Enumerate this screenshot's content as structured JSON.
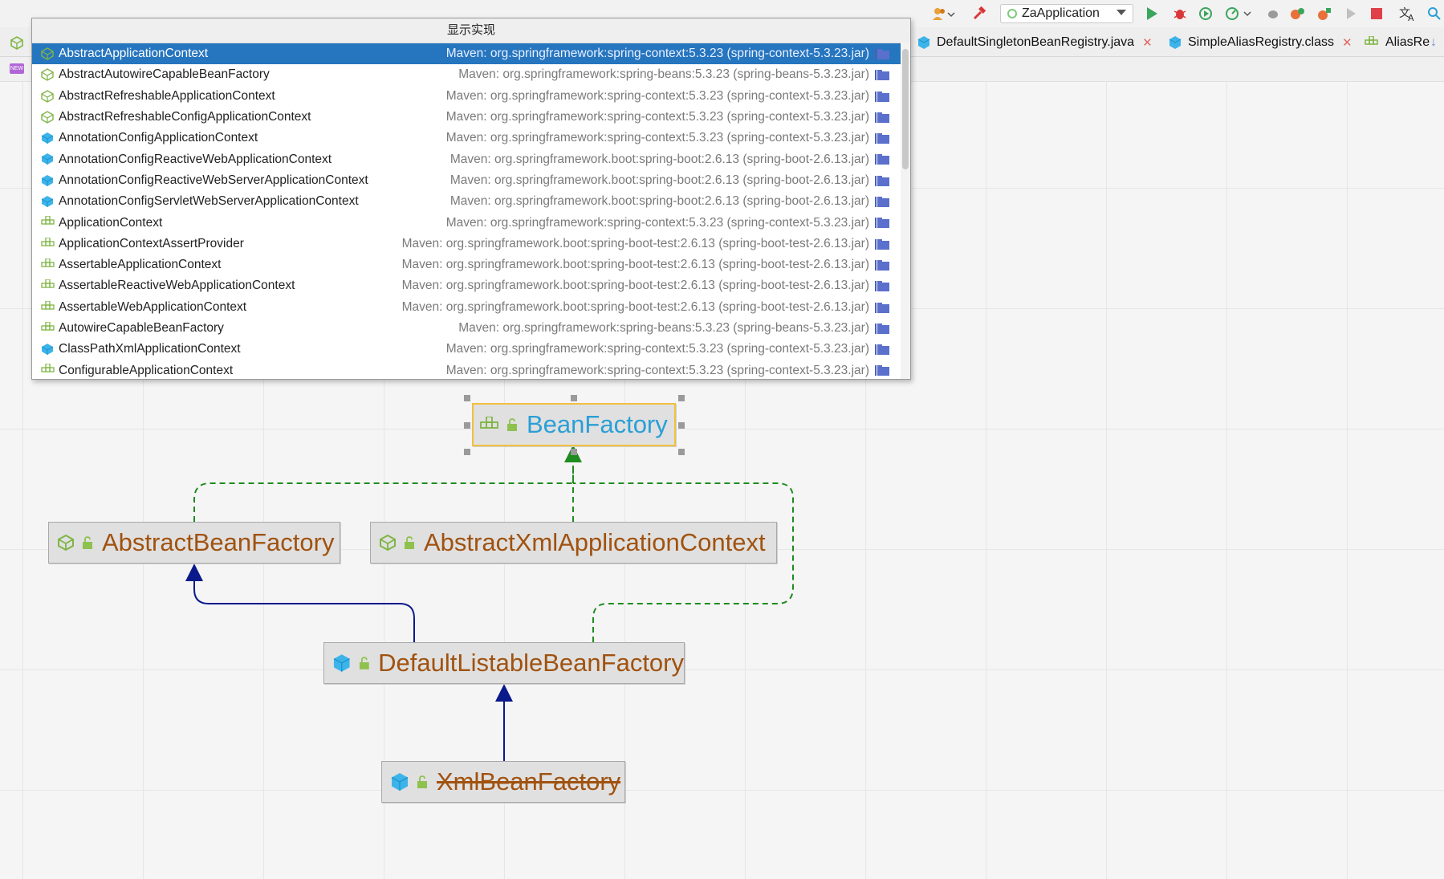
{
  "toolbar": {
    "run_config": "ZaApplication"
  },
  "tabs": [
    {
      "label": "DefaultSingletonBeanRegistry.java",
      "icon": "class-icon"
    },
    {
      "label": "SimpleAliasRegistry.class",
      "icon": "class-icon"
    },
    {
      "label": "AliasRe",
      "icon": "interface-icon"
    }
  ],
  "subbar": {
    "badge": "NEW"
  },
  "popup": {
    "title": "显示实现",
    "items": [
      {
        "name": "AbstractApplicationContext",
        "location": "Maven: org.springframework:spring-context:5.3.23 (spring-context-5.3.23.jar)",
        "kind": "abstract-class",
        "selected": true
      },
      {
        "name": "AbstractAutowireCapableBeanFactory",
        "location": "Maven: org.springframework:spring-beans:5.3.23 (spring-beans-5.3.23.jar)",
        "kind": "abstract-class"
      },
      {
        "name": "AbstractRefreshableApplicationContext",
        "location": "Maven: org.springframework:spring-context:5.3.23 (spring-context-5.3.23.jar)",
        "kind": "abstract-class"
      },
      {
        "name": "AbstractRefreshableConfigApplicationContext",
        "location": "Maven: org.springframework:spring-context:5.3.23 (spring-context-5.3.23.jar)",
        "kind": "abstract-class"
      },
      {
        "name": "AnnotationConfigApplicationContext",
        "location": "Maven: org.springframework:spring-context:5.3.23 (spring-context-5.3.23.jar)",
        "kind": "class"
      },
      {
        "name": "AnnotationConfigReactiveWebApplicationContext",
        "location": "Maven: org.springframework.boot:spring-boot:2.6.13 (spring-boot-2.6.13.jar)",
        "kind": "class"
      },
      {
        "name": "AnnotationConfigReactiveWebServerApplicationContext",
        "location": "Maven: org.springframework.boot:spring-boot:2.6.13 (spring-boot-2.6.13.jar)",
        "kind": "class"
      },
      {
        "name": "AnnotationConfigServletWebServerApplicationContext",
        "location": "Maven: org.springframework.boot:spring-boot:2.6.13 (spring-boot-2.6.13.jar)",
        "kind": "class"
      },
      {
        "name": "ApplicationContext",
        "location": "Maven: org.springframework:spring-context:5.3.23 (spring-context-5.3.23.jar)",
        "kind": "interface"
      },
      {
        "name": "ApplicationContextAssertProvider",
        "location": "Maven: org.springframework.boot:spring-boot-test:2.6.13 (spring-boot-test-2.6.13.jar)",
        "kind": "interface"
      },
      {
        "name": "AssertableApplicationContext",
        "location": "Maven: org.springframework.boot:spring-boot-test:2.6.13 (spring-boot-test-2.6.13.jar)",
        "kind": "interface"
      },
      {
        "name": "AssertableReactiveWebApplicationContext",
        "location": "Maven: org.springframework.boot:spring-boot-test:2.6.13 (spring-boot-test-2.6.13.jar)",
        "kind": "interface"
      },
      {
        "name": "AssertableWebApplicationContext",
        "location": "Maven: org.springframework.boot:spring-boot-test:2.6.13 (spring-boot-test-2.6.13.jar)",
        "kind": "interface"
      },
      {
        "name": "AutowireCapableBeanFactory",
        "location": "Maven: org.springframework:spring-beans:5.3.23 (spring-beans-5.3.23.jar)",
        "kind": "interface"
      },
      {
        "name": "ClassPathXmlApplicationContext",
        "location": "Maven: org.springframework:spring-context:5.3.23 (spring-context-5.3.23.jar)",
        "kind": "class"
      },
      {
        "name": "ConfigurableApplicationContext",
        "location": "Maven: org.springframework:spring-context:5.3.23 (spring-context-5.3.23.jar)",
        "kind": "interface"
      }
    ]
  },
  "diagram": {
    "nodes": {
      "bean_factory": "BeanFactory",
      "abstract_bean_factory": "AbstractBeanFactory",
      "abstract_xml_application_context": "AbstractXmlApplicationContext",
      "default_listable_bean_factory": "DefaultListableBeanFactory",
      "xml_bean_factory": "XmlBeanFactory"
    }
  },
  "colors": {
    "selection": "#2675bf",
    "class_name": "#a0520f",
    "selected_name": "#2a9fd6",
    "implements_edge": "#1e8c1e",
    "extends_edge": "#0b1a8a"
  }
}
